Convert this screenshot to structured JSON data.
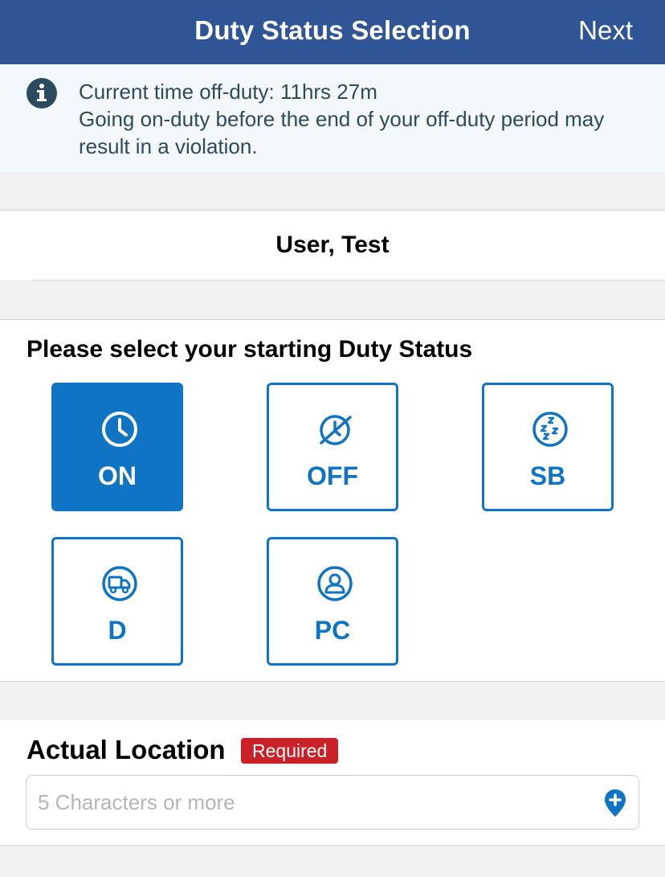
{
  "navbar": {
    "title": "Duty Status Selection",
    "next_label": "Next"
  },
  "banner": {
    "icon": "info-icon",
    "line1": "Current time off-duty: 11hrs 27m",
    "line2": "Going on-duty before the end of your off-duty period may result in a violation."
  },
  "user": {
    "name": "User, Test"
  },
  "duty_status": {
    "heading": "Please select your starting Duty Status",
    "options": [
      {
        "label": "ON",
        "icon": "clock-icon",
        "selected": true
      },
      {
        "label": "OFF",
        "icon": "clock-off-icon",
        "selected": false
      },
      {
        "label": "SB",
        "icon": "sleep-icon",
        "selected": false
      },
      {
        "label": "D",
        "icon": "truck-icon",
        "selected": false
      },
      {
        "label": "PC",
        "icon": "person-icon",
        "selected": false
      }
    ]
  },
  "location": {
    "heading": "Actual Location",
    "badge": "Required",
    "placeholder": "5 Characters or more",
    "value": "",
    "icon": "add-location-pin-icon"
  },
  "colors": {
    "navbar": "#2f5597",
    "accent": "#0f74c4",
    "required": "#c92127",
    "banner_bg": "#f2f8fc"
  }
}
